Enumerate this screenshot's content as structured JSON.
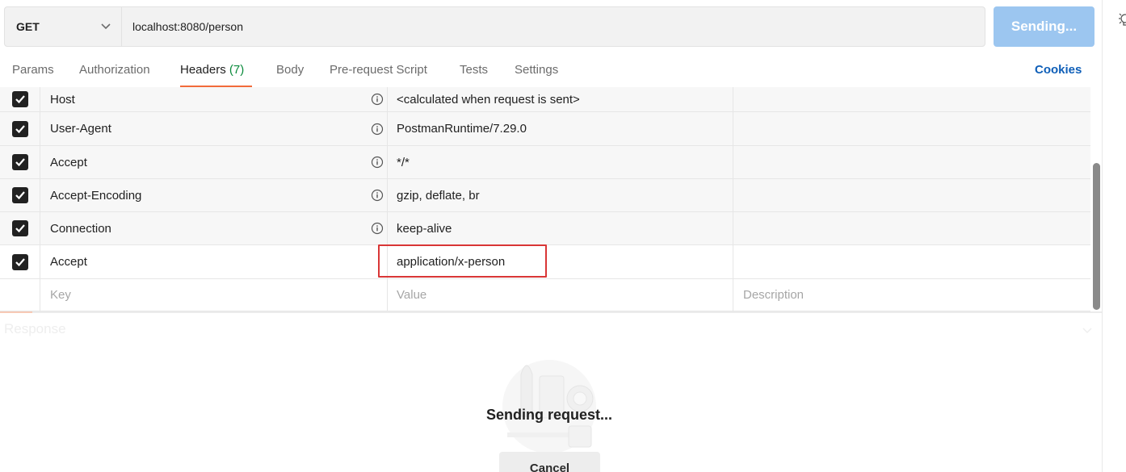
{
  "request": {
    "method": "GET",
    "url": "localhost:8080/person",
    "send_label": "Sending..."
  },
  "tabs": [
    {
      "label": "Params"
    },
    {
      "label": "Authorization"
    },
    {
      "label": "Headers",
      "count": "(7)",
      "active": true
    },
    {
      "label": "Body"
    },
    {
      "label": "Pre-request Script"
    },
    {
      "label": "Tests"
    },
    {
      "label": "Settings"
    }
  ],
  "cookies_label": "Cookies",
  "headers": [
    {
      "key": "Host",
      "value": "<calculated when request is sent>",
      "checked": true,
      "auto": true
    },
    {
      "key": "User-Agent",
      "value": "PostmanRuntime/7.29.0",
      "checked": true,
      "auto": true
    },
    {
      "key": "Accept",
      "value": "*/*",
      "checked": true,
      "auto": true
    },
    {
      "key": "Accept-Encoding",
      "value": "gzip, deflate, br",
      "checked": true,
      "auto": true
    },
    {
      "key": "Connection",
      "value": "keep-alive",
      "checked": true,
      "auto": true
    },
    {
      "key": "Accept",
      "value": "application/x-person",
      "checked": true,
      "auto": false
    }
  ],
  "new_row": {
    "key_placeholder": "Key",
    "value_placeholder": "Value",
    "description_placeholder": "Description"
  },
  "response": {
    "label": "Response",
    "status_text": "Sending request...",
    "cancel_label": "Cancel"
  },
  "colors": {
    "accent_orange": "#f26b3a",
    "send_button": "#9cc6f0",
    "link_blue": "#0f5fb8",
    "highlight_red": "#d93636"
  }
}
